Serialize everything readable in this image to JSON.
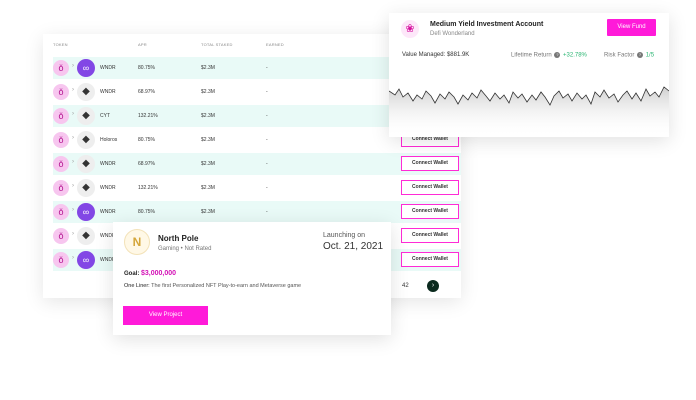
{
  "table": {
    "headers": [
      "TOKEN",
      "APR",
      "TOTAL STAKED",
      "EARNED"
    ],
    "rows": [
      {
        "name": "WNDR",
        "chain": "link",
        "apr": "80.75%",
        "staked": "$2.3M",
        "earned": "-",
        "tinted": true
      },
      {
        "name": "WNDR",
        "chain": "eth",
        "apr": "68.97%",
        "staked": "$2.3M",
        "earned": "-",
        "tinted": false
      },
      {
        "name": "CYT",
        "chain": "eth",
        "apr": "132.21%",
        "staked": "$2.3M",
        "earned": "-",
        "tinted": true
      },
      {
        "name": "Holoros",
        "chain": "eth",
        "apr": "80.75%",
        "staked": "$2.3M",
        "earned": "-",
        "tinted": false
      },
      {
        "name": "WNDR",
        "chain": "eth",
        "apr": "68.97%",
        "staked": "$2.3M",
        "earned": "-",
        "tinted": true
      },
      {
        "name": "WNDR",
        "chain": "eth",
        "apr": "132.21%",
        "staked": "$2.3M",
        "earned": "-",
        "tinted": false
      },
      {
        "name": "WNDR",
        "chain": "link",
        "apr": "80.75%",
        "staked": "$2.3M",
        "earned": "-",
        "tinted": true
      },
      {
        "name": "WNDR",
        "chain": "eth",
        "apr": "",
        "staked": "",
        "earned": "",
        "tinted": false
      },
      {
        "name": "WNDR",
        "chain": "link",
        "apr": "",
        "staked": "",
        "earned": "",
        "tinted": true
      }
    ],
    "wallet_button_label": "Connect Wallet",
    "page_number": "42"
  },
  "fund": {
    "title": "Medium Yield Investment Account",
    "subtitle": "Defi Wonderland",
    "button_label": "View Fund",
    "value_label": "Value Managed:",
    "value": "$881.9K",
    "return_label": "Lifetime Return",
    "return_value": "+32.78%",
    "risk_label": "Risk Factor",
    "risk_value": "1/5",
    "colors": {
      "accent": "#ff1ad9",
      "positive": "#2bb673",
      "sparkline": "#333333"
    }
  },
  "project": {
    "name": "North Pole",
    "meta": "Gaming • Not Rated",
    "launch_label": "Launching on",
    "launch_date": "Oct. 21, 2021",
    "goal_label": "Goal:",
    "goal_value": "$3,000,000",
    "oneliner_label": "One Liner:",
    "oneliner": "The first Personalized NFT Play-to-earn and Metaverse game",
    "button_label": "View Project"
  }
}
